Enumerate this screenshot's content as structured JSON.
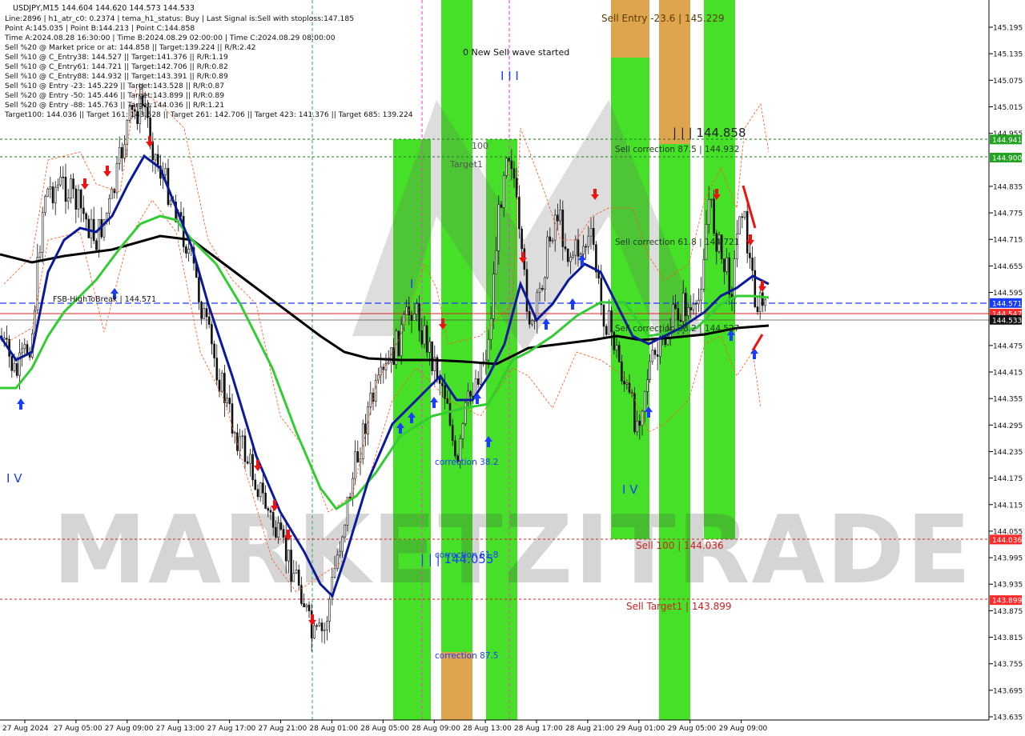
{
  "chart_data": {
    "type": "candlestick",
    "symbol_header": "USDJPY,M15  144.604 144.620 144.573 144.533",
    "info_lines": [
      "Line:2896 | h1_atr_c0: 0.2374 | tema_h1_status: Buy | Last Signal is:Sell with stoploss:147.185",
      "Point A:145.035 | Point B:144.213 | Point C:144.858",
      "Time A:2024.08.28 16:30:00 | Time B:2024.08.29 02:00:00 | Time C:2024.08.29 08:00:00",
      "Sell %20 @ Market price or at: 144.858 || Target:139.224 || R/R:2.42",
      "Sell %10 @ C_Entry38: 144.527 || Target:141.376 || R/R:1.19",
      "Sell %10 @ C_Entry61: 144.721 || Target:142.706 || R/R:0.82",
      "Sell %10 @ C_Entry88: 144.932 || Target:143.391 || R/R:0.89",
      "Sell %10 @ Entry -23: 145.229 || Target:143.528 || R/R:0.87",
      "Sell %20 @ Entry -50: 145.446 || Target:143.899 || R/R:0.89",
      "Sell %20 @ Entry -88: 145.763 || Target:144.036 || R/R:1.21",
      "Target100: 144.036 || Target 161: 143.528 || Target 261: 142.706 || Target 423: 141.376 || Target 685: 139.224"
    ],
    "y_ticks": [
      "145.195",
      "145.135",
      "145.075",
      "145.015",
      "144.955",
      "144.835",
      "144.775",
      "144.715",
      "144.655",
      "144.595",
      "144.475",
      "144.415",
      "144.355",
      "144.295",
      "144.235",
      "144.175",
      "144.115",
      "144.055",
      "143.995",
      "143.935",
      "143.875",
      "143.815",
      "143.755",
      "143.695",
      "143.635"
    ],
    "x_ticks": [
      "27 Aug 2024",
      "27 Aug 05:00",
      "27 Aug 09:00",
      "27 Aug 13:00",
      "27 Aug 17:00",
      "27 Aug 21:00",
      "28 Aug 01:00",
      "28 Aug 05:00",
      "28 Aug 09:00",
      "28 Aug 13:00",
      "28 Aug 17:00",
      "28 Aug 21:00",
      "29 Aug 01:00",
      "29 Aug 05:00",
      "29 Aug 09:00"
    ],
    "price_badges": [
      {
        "label": "144.941",
        "value": 144.941,
        "color": "#22a322"
      },
      {
        "label": "144.900",
        "value": 144.9,
        "color": "#22a322"
      },
      {
        "label": "144.571",
        "value": 144.571,
        "color": "#1a3cff"
      },
      {
        "label": "144.547",
        "value": 144.547,
        "color": "#ff2a2a"
      },
      {
        "label": "144.533",
        "value": 144.533,
        "color": "#111111"
      },
      {
        "label": "144.036",
        "value": 144.036,
        "color": "#ff2a2a"
      },
      {
        "label": "143.899",
        "value": 143.899,
        "color": "#ff2a2a"
      }
    ],
    "annotations": {
      "new_sell_wave": "0 New Sell wave started",
      "sell_entry": "Sell Entry -23.6 | 145.229",
      "point_c": "| | | 144.858",
      "sell_corr_875": "Sell correction 87.5 | 144.932",
      "sell_corr_618": "Sell correction 61.8 | 144.721",
      "sell_corr_382": "Sell correction 38.2 | 144.527",
      "sell_100": "Sell 100 | 144.036",
      "sell_target1": "Sell Target1 | 143.899",
      "point_b": "| | | 144.055",
      "corr_382": "correction 38.2",
      "corr_618": "correction 61.8",
      "corr_875": "correction 87.5",
      "fsb": "FSB-HighToBreak | 144.571",
      "label_100": "100",
      "target1": "Target1",
      "wave_iii": "I I I",
      "wave_i": "I",
      "wave_iv_left": "I V",
      "wave_iv_right": "I V",
      "watermark": "MARKETZITRADE"
    },
    "colors": {
      "bull_zone": "#33dd11",
      "bear_zone": "#e8a050",
      "blue_ma": "#0a1a9a",
      "green_ma": "#33cc33",
      "black_ma": "#000000",
      "target_red": "#cc2222",
      "target_green": "#1a7a1a"
    }
  }
}
